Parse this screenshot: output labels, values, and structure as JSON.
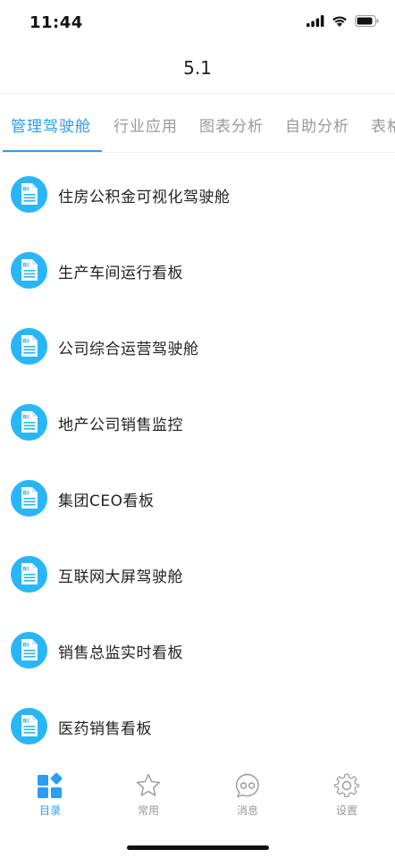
{
  "status_bar": {
    "time": "11:44"
  },
  "nav": {
    "title": "5.1"
  },
  "tabs": [
    {
      "label": "管理驾驶舱",
      "active": true
    },
    {
      "label": "行业应用",
      "active": false
    },
    {
      "label": "图表分析",
      "active": false
    },
    {
      "label": "自助分析",
      "active": false
    },
    {
      "label": "表格",
      "active": false
    }
  ],
  "list": {
    "icon": "bi-report-icon",
    "items": [
      {
        "label": "住房公积金可视化驾驶舱"
      },
      {
        "label": "生产车间运行看板"
      },
      {
        "label": "公司综合运营驾驶舱"
      },
      {
        "label": "地产公司销售监控"
      },
      {
        "label": "集团CEO看板"
      },
      {
        "label": "互联网大屏驾驶舱"
      },
      {
        "label": "销售总监实时看板"
      },
      {
        "label": "医药销售看板"
      }
    ]
  },
  "bottom_nav": [
    {
      "label": "目录",
      "icon": "catalog-icon",
      "active": true
    },
    {
      "label": "常用",
      "icon": "star-icon",
      "active": false
    },
    {
      "label": "消息",
      "icon": "message-icon",
      "active": false
    },
    {
      "label": "设置",
      "icon": "settings-gear-icon",
      "active": false
    }
  ],
  "colors": {
    "accent": "#2a9df4",
    "icon_bg": "#29b6f6",
    "inactive": "#999999"
  }
}
